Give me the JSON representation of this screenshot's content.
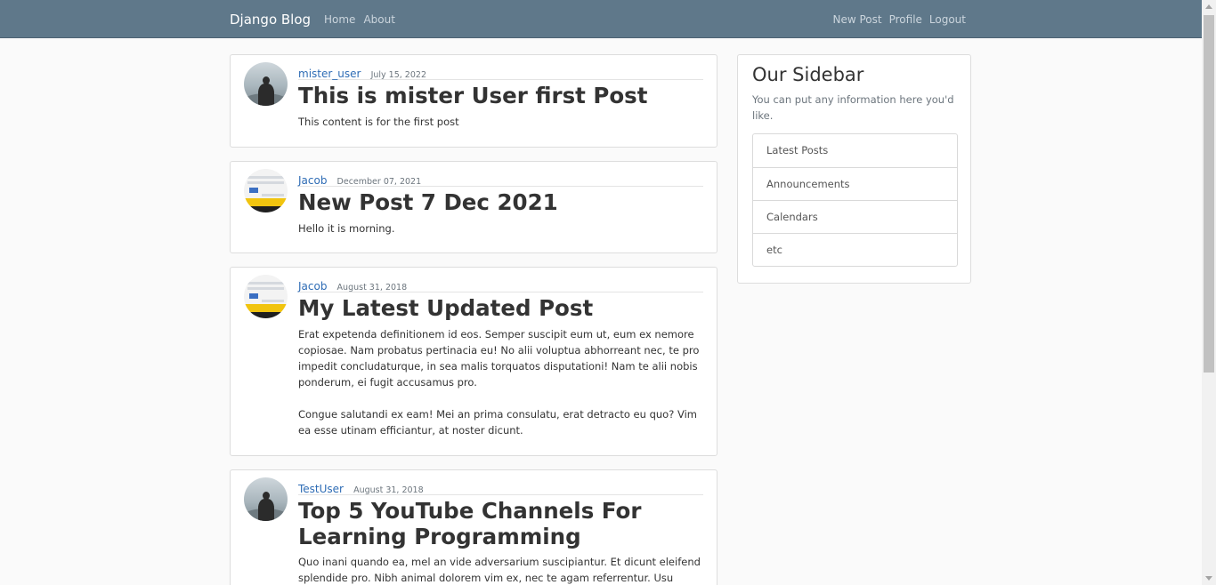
{
  "navbar": {
    "brand": "Django Blog",
    "left_links": [
      "Home",
      "About"
    ],
    "right_links": [
      "New Post",
      "Profile",
      "Logout"
    ],
    "color": "#5f788a"
  },
  "posts": [
    {
      "author": "mister_user",
      "date": "July 15, 2022",
      "title": "This is mister User first Post",
      "paragraphs": [
        "This content is for the first post"
      ],
      "avatar": "silhouette-avatar"
    },
    {
      "author": "Jacob",
      "date": "December 07, 2021",
      "title": "New Post 7 Dec 2021",
      "paragraphs": [
        "Hello it is morning."
      ],
      "avatar": "screenshot-avatar"
    },
    {
      "author": "Jacob",
      "date": "August 31, 2018",
      "title": "My Latest Updated Post",
      "paragraphs": [
        "Erat expetenda definitionem id eos. Semper suscipit eum ut, eum ex nemore copiosae. Nam probatus pertinacia eu! No alii voluptua abhorreant nec, te pro impedit concludaturque, in sea malis torquatos disputationi! Nam te alii nobis ponderum, ei fugit accusamus pro.",
        "Congue salutandi ex eam! Mei an prima consulatu, erat detracto eu quo? Vim ea esse utinam efficiantur, at noster dicunt."
      ],
      "avatar": "screenshot-avatar"
    },
    {
      "author": "TestUser",
      "date": "August 31, 2018",
      "title": "Top 5 YouTube Channels For Learning Programming",
      "paragraphs": [
        "Quo inani quando ea, mel an vide adversarium suscipiantur. Et dicunt eleifend splendide pro. Nibh animal dolorem vim ex, nec te agam referrentur. Usu admodum"
      ],
      "avatar": "silhouette-avatar"
    }
  ],
  "sidebar": {
    "title": "Our Sidebar",
    "description": "You can put any information here you'd like.",
    "items": [
      "Latest Posts",
      "Announcements",
      "Calendars",
      "etc"
    ]
  }
}
